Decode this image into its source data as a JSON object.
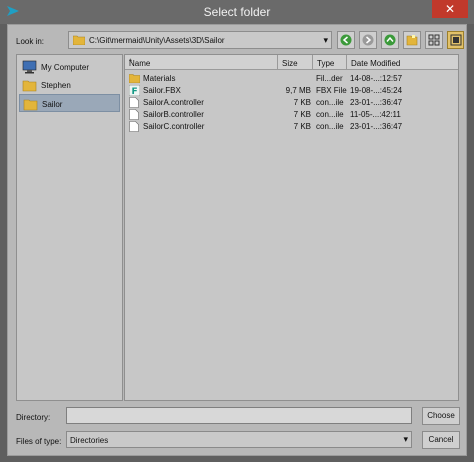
{
  "window": {
    "title": "Select folder",
    "close_glyph": "✕"
  },
  "toolbar": {
    "look_in_label": "Look in:",
    "path": "C:\\Git\\mermaid\\Unity\\Assets\\3D\\Sailor",
    "dropdown_arrow": "▾",
    "buttons": [
      "back-icon",
      "forward-icon",
      "parent-folder-icon",
      "new-folder-icon",
      "list-view-icon",
      "detail-view-icon"
    ]
  },
  "sidebar": {
    "items": [
      {
        "label": "My Computer",
        "icon": "computer-icon"
      },
      {
        "label": "Stephen",
        "icon": "folder-icon"
      },
      {
        "label": "Sailor",
        "icon": "folder-icon",
        "selected": true
      }
    ]
  },
  "filelist": {
    "columns": [
      "Name",
      "Size",
      "Type",
      "Date Modified"
    ],
    "sort_indicator": "^",
    "rows": [
      {
        "name": "Materials",
        "size": "",
        "type": "Fil...der",
        "date": "14-08-...:12:57",
        "icon": "folder-icon"
      },
      {
        "name": "Sailor.FBX",
        "size": "9,7 MB",
        "type": "FBX File",
        "date": "19-08-...:45:24",
        "icon": "fbx-file-icon"
      },
      {
        "name": "SailorA.controller",
        "size": "7 KB",
        "type": "con...ile",
        "date": "23-01-...:36:47",
        "icon": "file-icon"
      },
      {
        "name": "SailorB.controller",
        "size": "7 KB",
        "type": "con...ile",
        "date": "11-05-...:42:11",
        "icon": "file-icon"
      },
      {
        "name": "SailorC.controller",
        "size": "7 KB",
        "type": "con...ile",
        "date": "23-01-...:36:47",
        "icon": "file-icon"
      }
    ]
  },
  "footer": {
    "directory_label": "Directory:",
    "directory_value": "",
    "choose_label": "Choose",
    "files_of_type_label": "Files of type:",
    "files_of_type_value": "Directories",
    "dropdown_arrow": "▾",
    "cancel_label": "Cancel"
  },
  "colors": {
    "selection": "#9aa8b8",
    "close_red": "#c1392b",
    "folder_yellow": "#e3b53b",
    "nav_green": "#3b9a3a"
  }
}
